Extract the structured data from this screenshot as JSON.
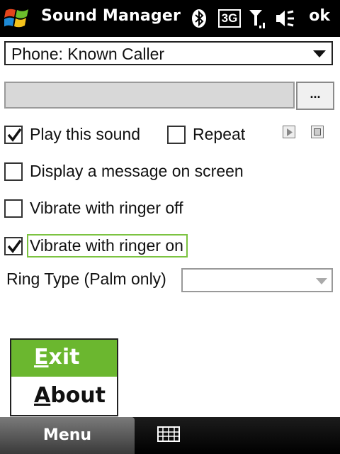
{
  "titlebar": {
    "title": "Sound Manager",
    "network": "3G",
    "ok_label": "ok"
  },
  "combo": {
    "value": "Phone: Known Caller"
  },
  "file": {
    "value": "",
    "browse_label": "..."
  },
  "options": {
    "play_sound": {
      "label": "Play this sound",
      "checked": true
    },
    "repeat": {
      "label": "Repeat",
      "checked": false
    },
    "display_message": {
      "label": "Display a message on screen",
      "checked": false
    },
    "vibrate_off": {
      "label": "Vibrate with ringer off",
      "checked": false
    },
    "vibrate_on": {
      "label": "Vibrate with ringer on",
      "checked": true
    }
  },
  "ring_type": {
    "label": "Ring Type (Palm only)",
    "value": ""
  },
  "menu": {
    "exit_accel": "E",
    "exit_rest": "xit",
    "about_accel": "A",
    "about_rest": "bout"
  },
  "softkeys": {
    "left": "Menu"
  },
  "colors": {
    "accent": "#6bb72f",
    "focus": "#7cc341"
  }
}
